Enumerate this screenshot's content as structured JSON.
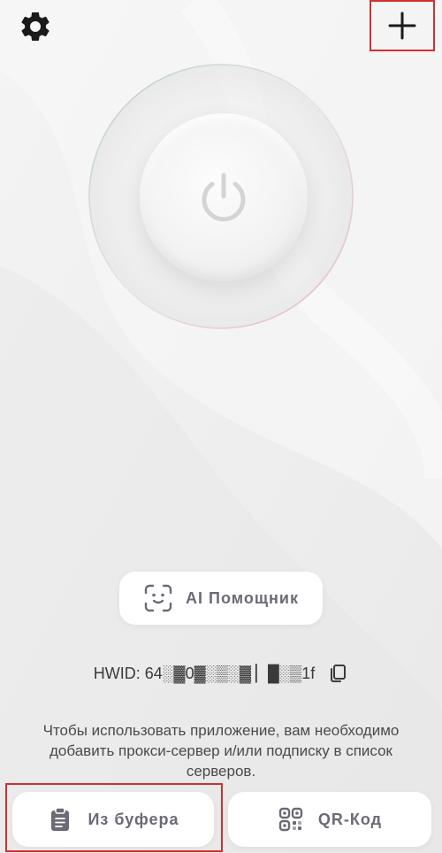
{
  "header": {
    "settings_icon": "gear-icon",
    "add_icon": "plus-icon"
  },
  "main": {
    "power_icon": "power-icon"
  },
  "ai_assistant": {
    "label": "AI Помощник",
    "icon": "face-scan-icon"
  },
  "hwid": {
    "text": "HWID: 64░▓0▓░▒░▓ ▏█░▒1f",
    "copy_icon": "copy-icon"
  },
  "info": {
    "message": "Чтобы использовать приложение, вам необходимо добавить прокси-сервер и/или подписку в список серверов."
  },
  "bottom": {
    "clipboard_label": "Из буфера",
    "clipboard_icon": "clipboard-icon",
    "qr_label": "QR-Код",
    "qr_icon": "qr-code-icon"
  },
  "colors": {
    "accent": "#6b6a76",
    "highlight": "#d32f2f",
    "background": "#eeeeee"
  }
}
